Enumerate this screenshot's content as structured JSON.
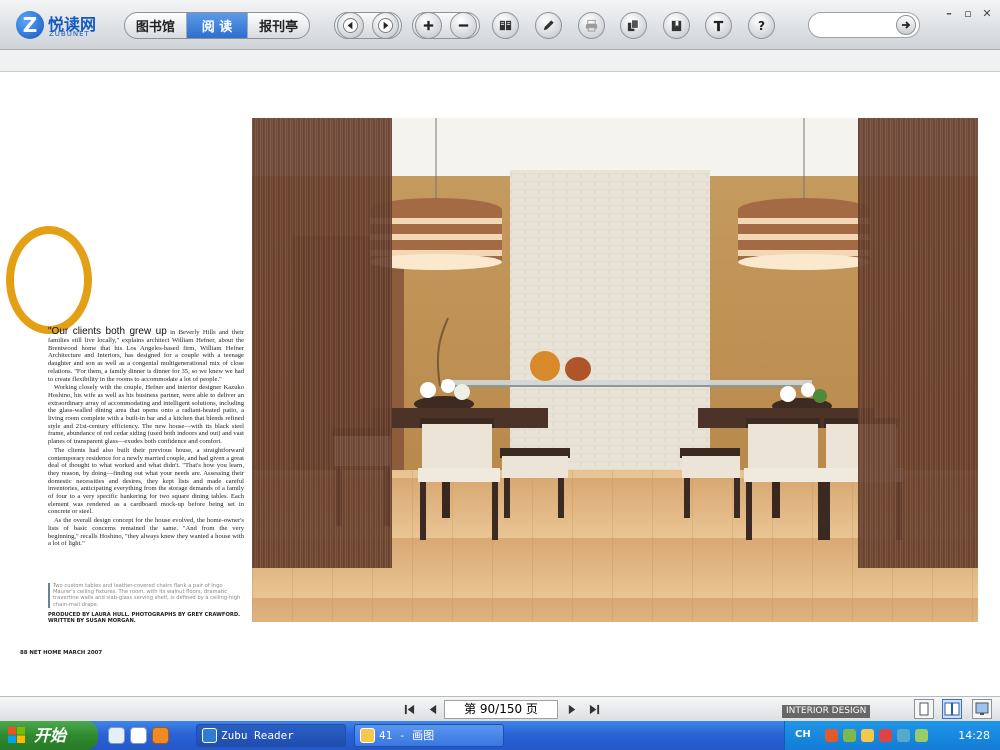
{
  "app": {
    "logo_letter": "Z",
    "logo_text": "悦读网",
    "logo_subtext": "ZUBUNET"
  },
  "toolbar": {
    "tabs": [
      {
        "label": "图书馆",
        "active": false
      },
      {
        "label": "阅 读",
        "active": true
      },
      {
        "label": "报刊亭",
        "active": false
      }
    ],
    "search_placeholder": ""
  },
  "article": {
    "lead": "\"Our clients both grew up",
    "lead_rest": " in Beverly Hills and their families still live locally,\" explains architect William Hefner, about the Brentwood home that his Los Angeles-based firm, William Hefner Architecture and Interiors, has designed for a couple with a teenage daughter and son as well as a congenial multigenerational mix of close relations. \"For them, a family dinner is dinner for 35, so we knew we had to create flexibility in the rooms to accommodate a lot of people.\"",
    "p2": "Working closely with the couple, Hefner and interior designer Kazuko Hoshino, his wife as well as his business partner, were able to deliver an extraordinary array of accommodating and intelligent solutions, including the glass-walled dining area that opens onto a radiant-heated patio, a living room complete with a built-in bar and a kitchen that blends refined style and 21st-century efficiency. The new house—with its black steel frame, abundance of red cedar siding (used both indoors and out) and vast planes of transparent glass—exudes both confidence and comfort.",
    "p3": "The clients had also built their previous house, a straightforward contemporary residence for a newly married couple, and had given a great deal of thought to what worked and what didn't. \"That's how you learn, they reason, by doing—finding out what your needs are. Assessing their domestic necessities and desires, they kept lists and made careful inventories, anticipating everything from the storage demands of a family of four to a very specific hankering for two square dining tables. Each element was rendered as a cardboard mock-up before being set in concrete or steel.",
    "p4": "As the overall design concept for the house evolved, the home-owner's lists of basic concerns remained the same. \"And from the very beginning,\" recalls Hoshino, \"they always knew they wanted a house with a lot of light.\"",
    "caption": "Two custom tables and leather-covered chairs flank a pair of Ingo Maurer's ceiling fixtures. The room, with its walnut floors, dramatic travertine walls and slab-glass serving shelf, is defined by a ceiling-high chain-mail drape.",
    "credits": "PRODUCED BY LAURA HULL. PHOTOGRAPHS BY GREY CRAWFORD. WRITTEN BY SUSAN MORGAN.",
    "folio": "88 NET HOME MARCH 2007"
  },
  "navigation": {
    "page_indicator": "第 90/150 页"
  },
  "watermark": {
    "text": "INTERIOR DESIGN"
  },
  "taskbar": {
    "start_label": "开始",
    "tasks": [
      {
        "label": "Zubu Reader",
        "active": true
      },
      {
        "label": "41 - 画图",
        "active": false
      }
    ],
    "tray_lang": "CH",
    "clock": "14:28"
  },
  "colors": {
    "accent_blue": "#2c6fcf",
    "quote_ring": "#e3a015",
    "taskbar": "#2a63d6",
    "start_green": "#2f8a2f"
  },
  "icons": [
    "back-icon",
    "forward-icon",
    "zoom-in-icon",
    "zoom-out-icon",
    "book-icon",
    "pen-icon",
    "print-icon",
    "export-icon",
    "bookmark-icon",
    "text-icon",
    "help-icon"
  ]
}
